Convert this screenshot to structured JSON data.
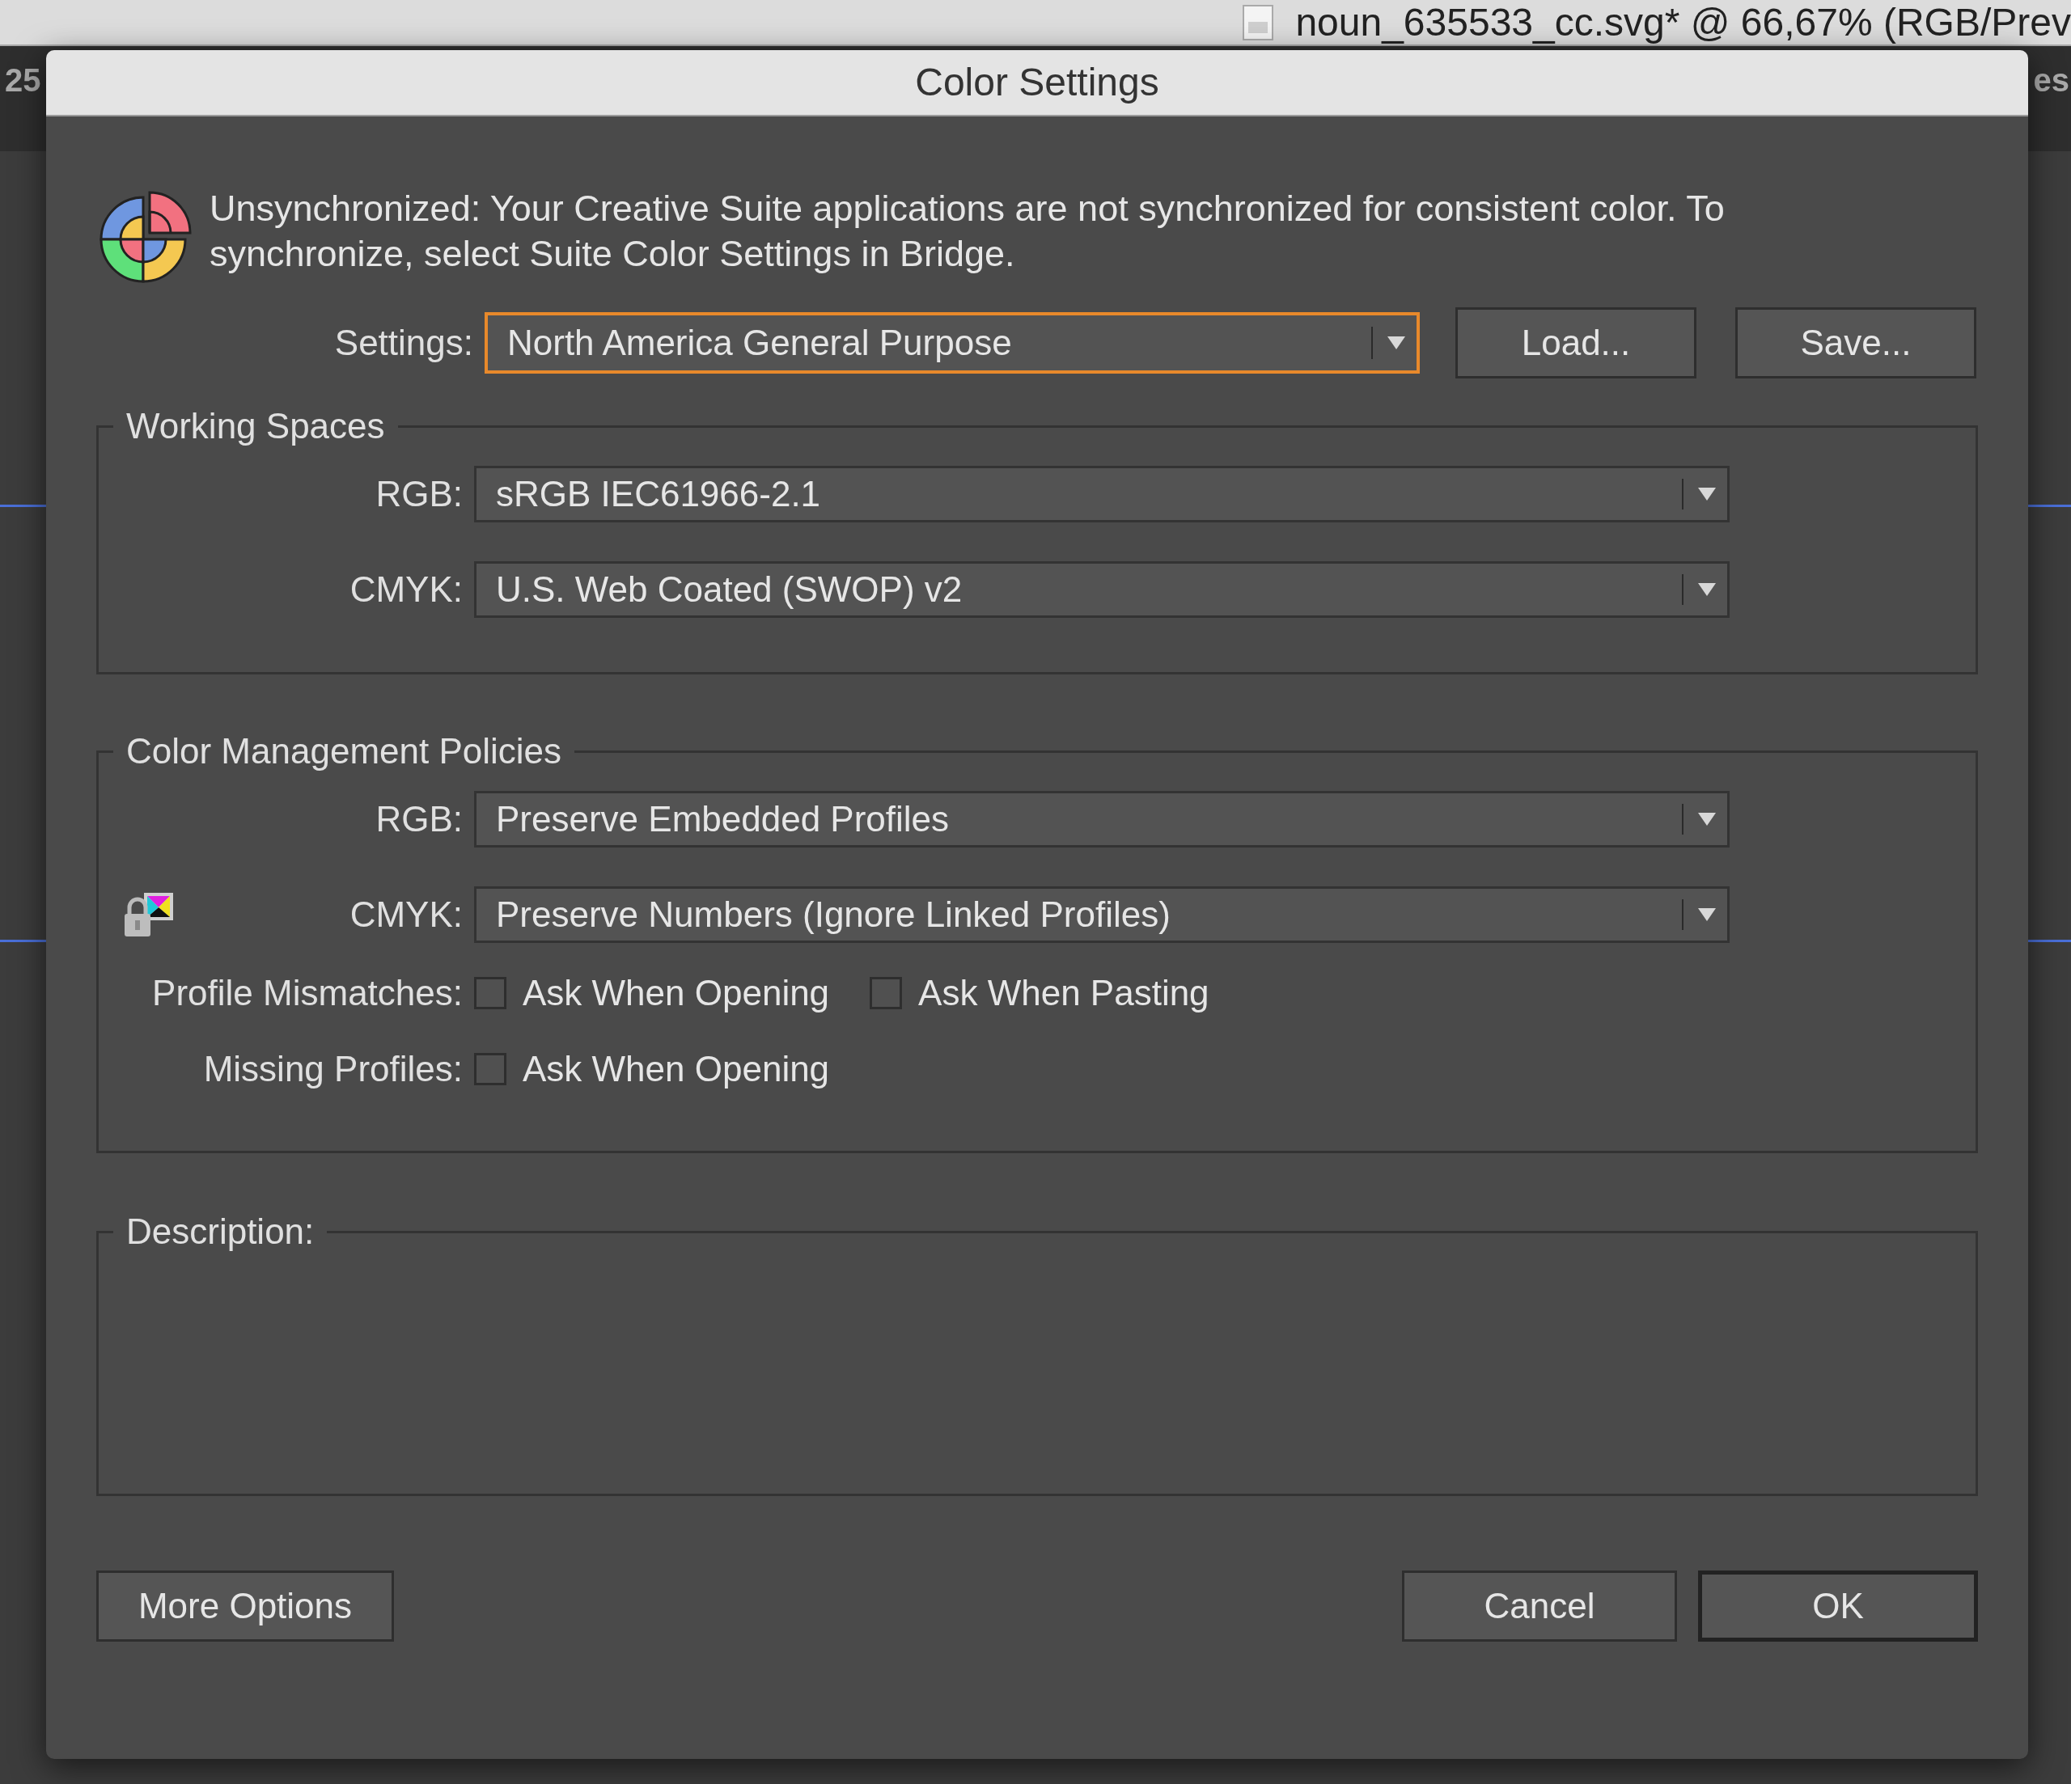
{
  "background": {
    "document_title": "noun_635533_cc.svg* @ 66,67% (RGB/Prev",
    "left_fragment": "25",
    "right_fragment": "es"
  },
  "dialog": {
    "title": "Color Settings",
    "message": "Unsynchronized: Your Creative Suite applications are not synchronized for consistent color. To synchronize, select Suite Color Settings in Bridge.",
    "settings": {
      "label": "Settings:",
      "value": "North America General Purpose",
      "focused": true
    },
    "settings_buttons": [
      "Load...",
      "Save..."
    ],
    "working_spaces": {
      "title": "Working Spaces",
      "rows": [
        {
          "label": "RGB:",
          "value": "sRGB IEC61966-2.1",
          "locked": false
        },
        {
          "label": "CMYK:",
          "value": "U.S. Web Coated (SWOP) v2",
          "locked": false
        }
      ]
    },
    "policies": {
      "title": "Color Management Policies",
      "rows": [
        {
          "label": "RGB:",
          "value": "Preserve Embedded Profiles",
          "locked": false
        },
        {
          "label": "CMYK:",
          "value": "Preserve Numbers (Ignore Linked Profiles)",
          "locked": true
        }
      ],
      "checkbox_rows": [
        {
          "label": "Profile Mismatches:",
          "options": [
            {
              "label": "Ask When Opening",
              "checked": false
            },
            {
              "label": "Ask When Pasting",
              "checked": false
            }
          ]
        },
        {
          "label": "Missing Profiles:",
          "options": [
            {
              "label": "Ask When Opening",
              "checked": false
            }
          ]
        }
      ]
    },
    "description": {
      "title": "Description:"
    },
    "footer_left": {
      "label": "More Options",
      "default": false
    },
    "footer_right": [
      {
        "label": "Cancel",
        "default": false
      },
      {
        "label": "OK",
        "default": true
      }
    ]
  }
}
